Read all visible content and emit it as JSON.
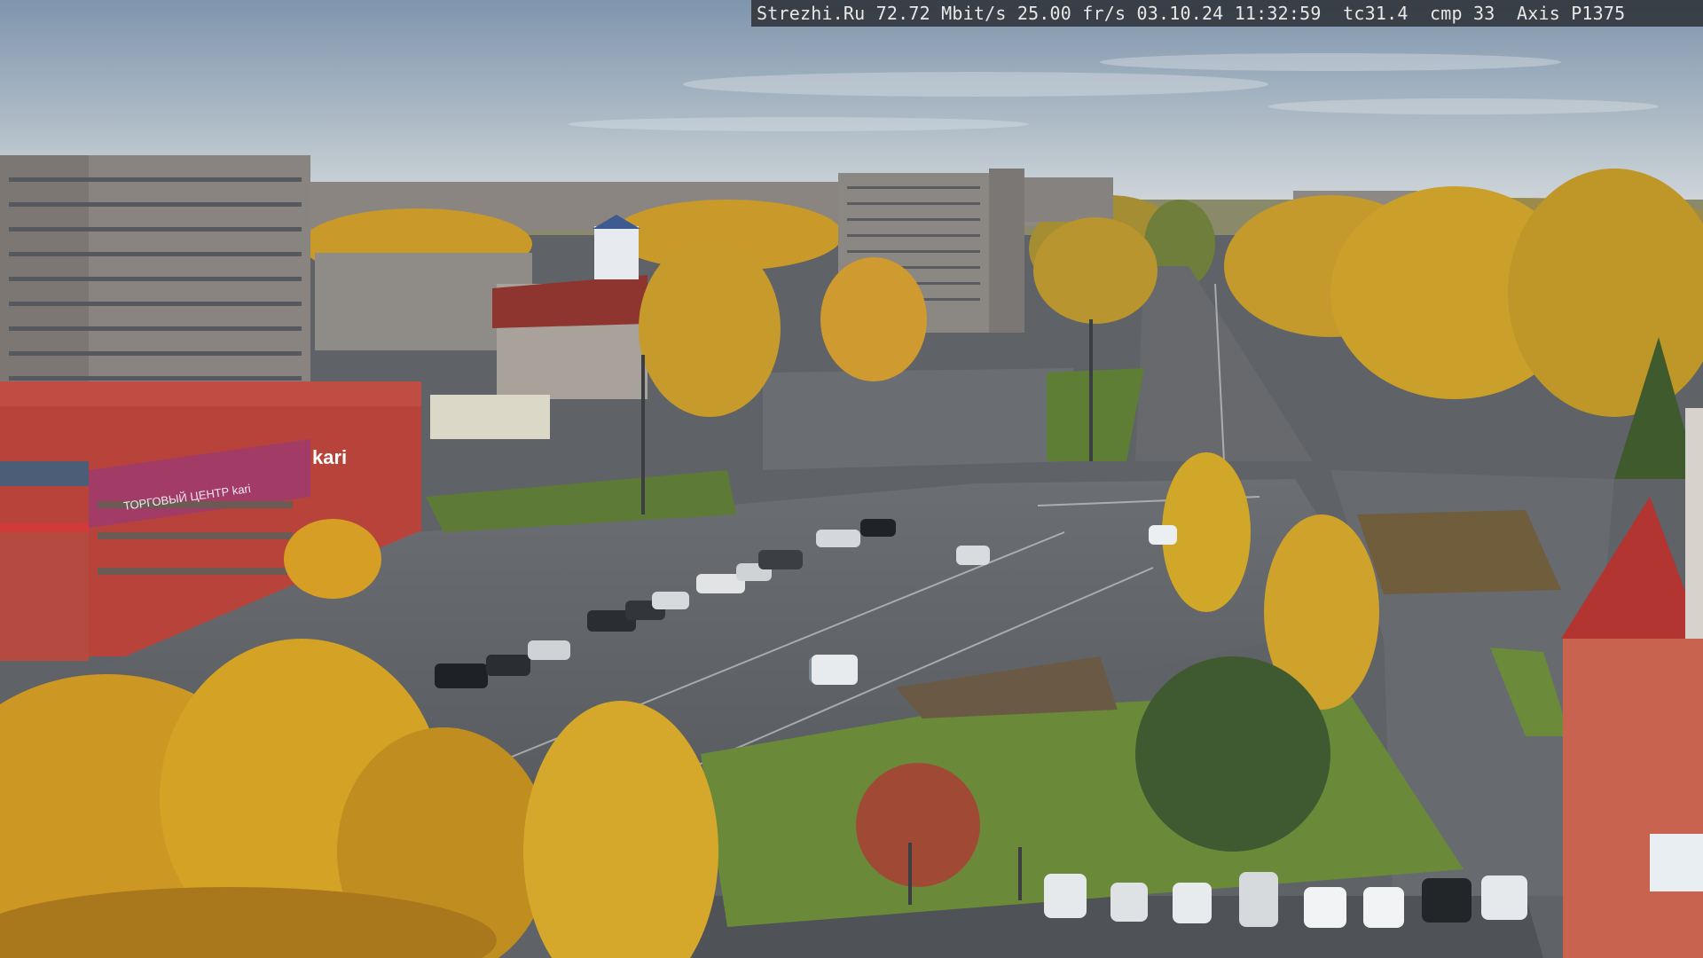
{
  "camera_overlay": {
    "site": "Strezhi.Ru",
    "bitrate": "72.72 Mbit/s",
    "framerate": "25.00 fr/s",
    "date": "03.10.24",
    "time": "11:32:59",
    "tc": "tc31.4",
    "cmp": "cmp 33",
    "camera_model": "Axis P1375"
  },
  "signs": {
    "store_brand": "kari",
    "store_banner": "ТОРГОВЫЙ ЦЕНТР kari"
  },
  "colors": {
    "sky_top": "#7f95ad",
    "sky_bottom": "#c9d2d8",
    "foliage": "#d9a21e",
    "road": "#5d6064",
    "grass": "#6b8a3a",
    "brick": "#b8433a"
  }
}
